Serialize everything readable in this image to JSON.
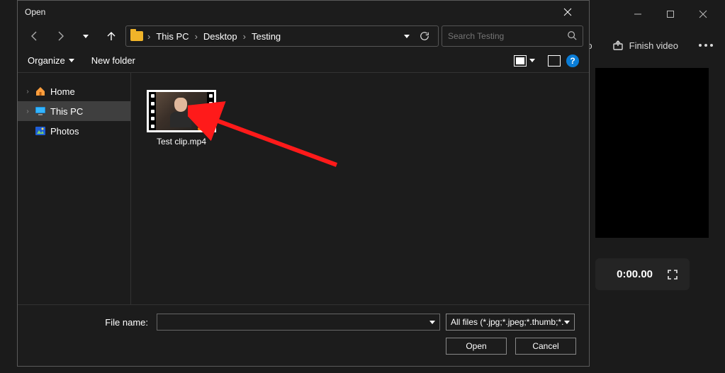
{
  "dialog": {
    "title": "Open",
    "breadcrumbs": [
      "This PC",
      "Desktop",
      "Testing"
    ],
    "search_placeholder": "Search Testing",
    "organize_label": "Organize",
    "new_folder_label": "New folder",
    "help_label": "?",
    "nav": {
      "items": [
        {
          "label": "Home",
          "icon": "home-icon"
        },
        {
          "label": "This PC",
          "icon": "monitor-icon",
          "selected": true
        },
        {
          "label": "Photos",
          "icon": "photos-icon"
        }
      ]
    },
    "files": [
      {
        "name": "Test clip.mp4"
      }
    ],
    "filename_label": "File name:",
    "filename_value": "",
    "filetype": "All files (*.jpg;*.jpeg;*.thumb;*.p",
    "open_label": "Open",
    "cancel_label": "Cancel"
  },
  "editor": {
    "toolbar": {
      "audio_label": "dio",
      "finish_label": "Finish video"
    },
    "time": "0:00.00"
  }
}
